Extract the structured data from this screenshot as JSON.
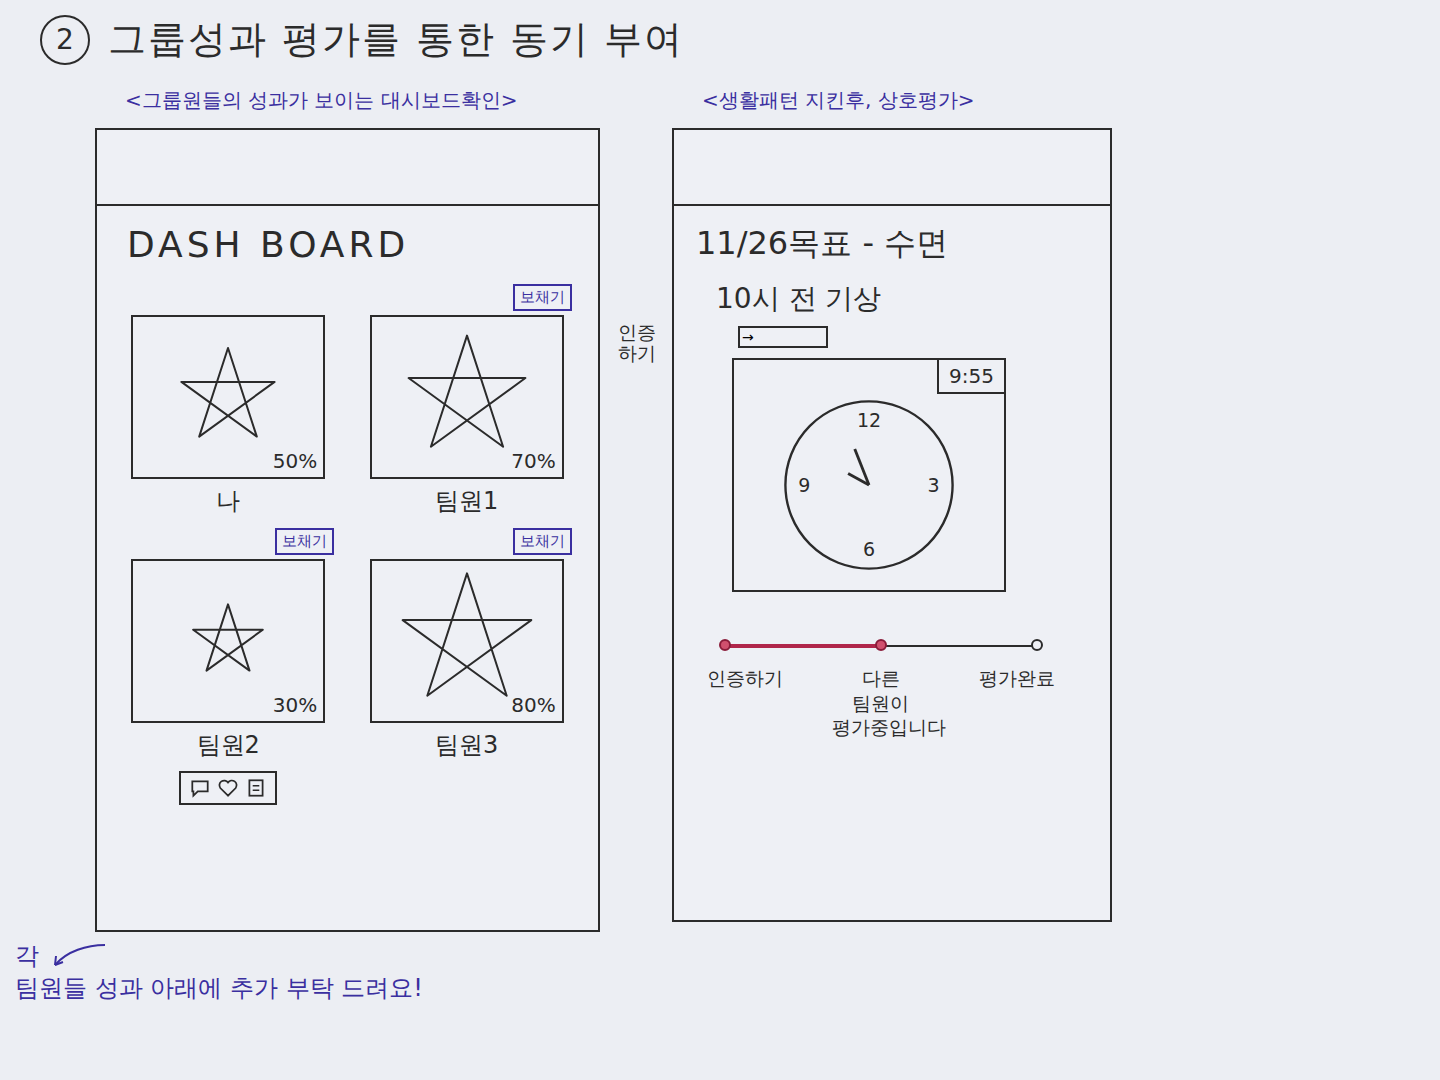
{
  "title": {
    "number": "2",
    "text": "그룹성과 평가를 통한 동기 부여"
  },
  "dashboard_screen": {
    "caption": "<그룹원들의 성과가 보이는 대시보드확인>",
    "heading": "DASH BOARD",
    "nudge_label": "보채기",
    "members": [
      {
        "name": "나",
        "percent": "50%",
        "level": 0.5,
        "nudge": false,
        "reactions": false
      },
      {
        "name": "팀원1",
        "percent": "70%",
        "level": 0.7,
        "nudge": true,
        "reactions": false
      },
      {
        "name": "팀원2",
        "percent": "30%",
        "level": 0.3,
        "nudge": true,
        "reactions": true
      },
      {
        "name": "팀원3",
        "percent": "80%",
        "level": 0.8,
        "nudge": true,
        "reactions": false
      }
    ],
    "note": [
      "각",
      "팀원들 성과 아래에 추가 부탁 드려요!"
    ]
  },
  "verify_screen": {
    "caption": "<생활패턴 지킨후, 상호평가>",
    "goal": "11/26목표 - 수면",
    "task": "10시 전 기상",
    "verify_note": "인증하기",
    "verify_button": "→",
    "photo": {
      "timestamp": "9:55",
      "dial": [
        "12",
        "3",
        "6",
        "9"
      ]
    },
    "progress": {
      "level": 0.5,
      "steps": [
        {
          "label": "인증하기",
          "done": true
        },
        {
          "label": "다른 팀원이 평가중입니다",
          "done": true
        },
        {
          "label": "평가완료",
          "done": false
        }
      ]
    }
  }
}
